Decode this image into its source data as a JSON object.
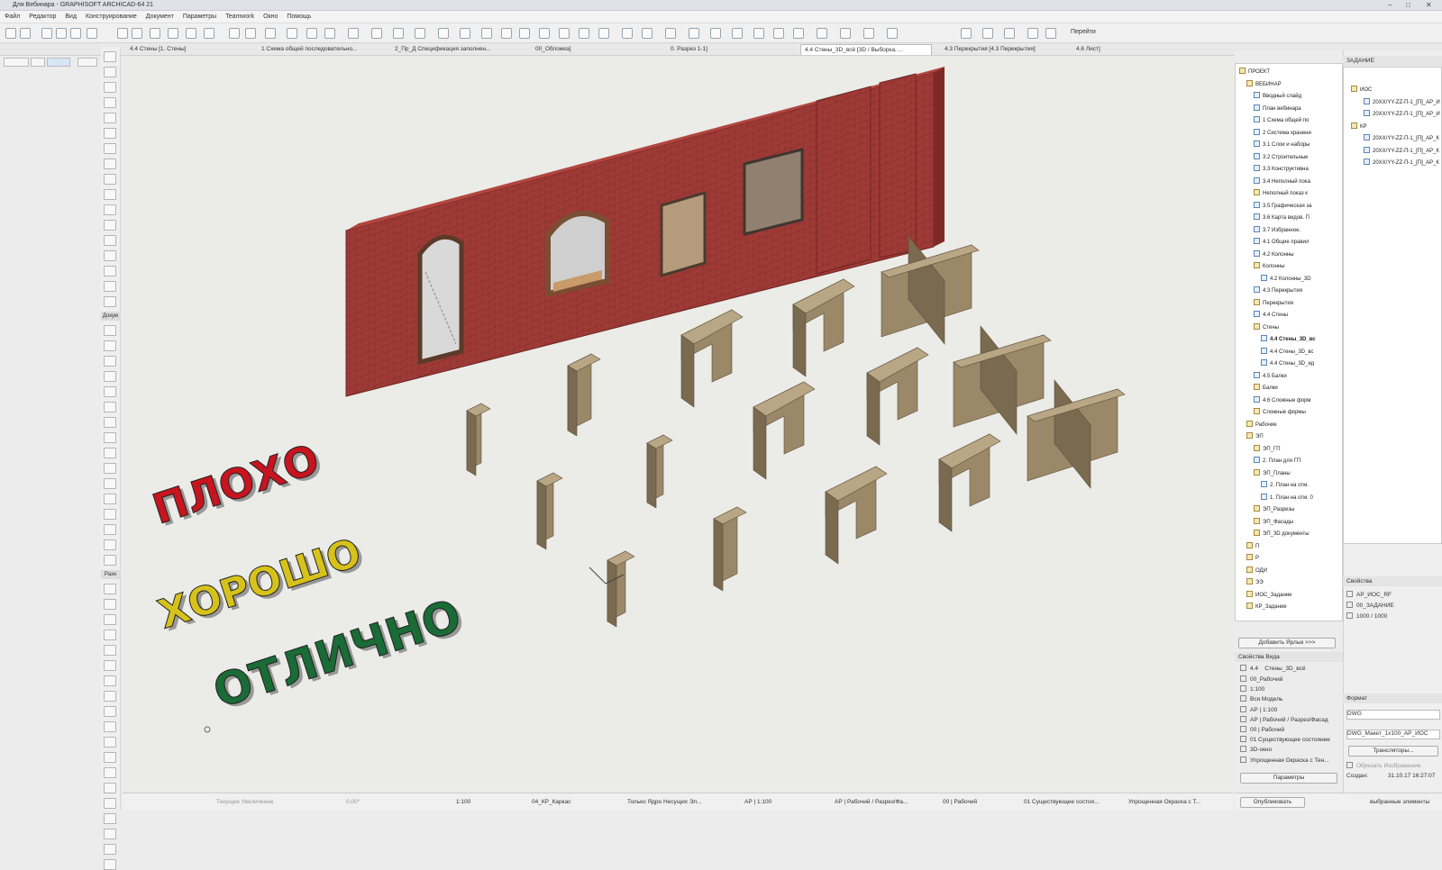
{
  "window": {
    "title": "Для Вебинара - GRAPHISOFT ARCHICAD-64 21",
    "controls": [
      "–",
      "□",
      "✕"
    ]
  },
  "menu": [
    "Файл",
    "Редактор",
    "Вид",
    "Конструирование",
    "Документ",
    "Параметры",
    "Teamwork",
    "Окно",
    "Помощь"
  ],
  "toolbar": {
    "goto_label": "Перейти"
  },
  "tabs": [
    {
      "label": "4.4 Стены [1. Стены]",
      "active": false
    },
    {
      "label": "1 Схема общей последовательно...",
      "active": false
    },
    {
      "label": "2_Пр_Д Спецификация заполнен...",
      "active": false
    },
    {
      "label": "00_Обложка]",
      "active": false
    },
    {
      "label": "0. Разрез 1-1]",
      "active": false
    },
    {
      "label": "4.4 Стены_3D_всё [3D / Выборка, ...",
      "active": true
    },
    {
      "label": "4.3 Перекрытия [4.3 Перекрытия]",
      "active": false
    },
    {
      "label": "4.6 Лист]",
      "active": false
    }
  ],
  "toolbox": {
    "section_design": "Докум",
    "section_docs": "Разн"
  },
  "viewport": {
    "wall_color": "#9e3a36",
    "wall_top_color": "#b2463f",
    "column_color": "#9b8868",
    "column_dark": "#7a6a50",
    "column_light": "#b8a684",
    "labels": [
      {
        "text": "ПЛОХО",
        "color": "#c8141e"
      },
      {
        "text": "ХОРОШО",
        "color": "#d6c21a"
      },
      {
        "text": "ОТЛИЧНО",
        "color": "#1a6b35"
      }
    ]
  },
  "navigator": {
    "items": [
      {
        "label": "ПРОЕКТ",
        "level": 0,
        "type": "folder"
      },
      {
        "label": "ВЕБИНАР",
        "level": 1,
        "type": "folder"
      },
      {
        "label": "Вводный слайд",
        "level": 2,
        "type": "view"
      },
      {
        "label": "План вебинара",
        "level": 2,
        "type": "view"
      },
      {
        "label": "1 Схема общей по",
        "level": 2,
        "type": "view"
      },
      {
        "label": "2 Система хранени",
        "level": 2,
        "type": "view"
      },
      {
        "label": "3.1 Слои и наборы",
        "level": 2,
        "type": "view"
      },
      {
        "label": "3.2 Строительные",
        "level": 2,
        "type": "view"
      },
      {
        "label": "3.3 Конструктивна",
        "level": 2,
        "type": "view"
      },
      {
        "label": "3.4 Неполный пока",
        "level": 2,
        "type": "view"
      },
      {
        "label": "Неполный показ к",
        "level": 2,
        "type": "folder"
      },
      {
        "label": "3.5 Графическая за",
        "level": 2,
        "type": "view"
      },
      {
        "label": "3.6 Карта видов. П",
        "level": 2,
        "type": "view"
      },
      {
        "label": "3.7 Избранное.",
        "level": 2,
        "type": "view"
      },
      {
        "label": "4.1 Общие правил",
        "level": 2,
        "type": "view"
      },
      {
        "label": "4.2 Колонны",
        "level": 2,
        "type": "view"
      },
      {
        "label": "Колонны",
        "level": 2,
        "type": "folder"
      },
      {
        "label": "4.2 Колонны_3D",
        "level": 3,
        "type": "view"
      },
      {
        "label": "4.3 Перекрытия",
        "level": 2,
        "type": "view"
      },
      {
        "label": "Перекрытия",
        "level": 2,
        "type": "folder"
      },
      {
        "label": "4.4 Стены",
        "level": 2,
        "type": "view"
      },
      {
        "label": "Стены",
        "level": 2,
        "type": "folder"
      },
      {
        "label": "4.4 Стены_3D_вс",
        "level": 3,
        "type": "view",
        "selected": true
      },
      {
        "label": "4.4 Стены_3D_вс",
        "level": 3,
        "type": "view"
      },
      {
        "label": "4.4 Стены_3D_ид",
        "level": 3,
        "type": "view"
      },
      {
        "label": "4.5 Балки",
        "level": 2,
        "type": "view"
      },
      {
        "label": "Балки",
        "level": 2,
        "type": "folder"
      },
      {
        "label": "4.6 Сложные форм",
        "level": 2,
        "type": "view"
      },
      {
        "label": "Сложные формы",
        "level": 2,
        "type": "folder"
      },
      {
        "label": "Рабочие",
        "level": 1,
        "type": "folder"
      },
      {
        "label": "ЭП",
        "level": 1,
        "type": "folder"
      },
      {
        "label": "ЭП_ГП",
        "level": 2,
        "type": "folder"
      },
      {
        "label": "2. План для ГП",
        "level": 2,
        "type": "view"
      },
      {
        "label": "ЭП_Планы",
        "level": 2,
        "type": "folder"
      },
      {
        "label": "2. План на отм.",
        "level": 3,
        "type": "view"
      },
      {
        "label": "1. План на отм. 0",
        "level": 3,
        "type": "view"
      },
      {
        "label": "ЭП_Разрезы",
        "level": 2,
        "type": "folder"
      },
      {
        "label": "ЭП_Фасады",
        "level": 2,
        "type": "folder"
      },
      {
        "label": "ЭП_3D документы",
        "level": 2,
        "type": "folder"
      },
      {
        "label": "П",
        "level": 1,
        "type": "folder"
      },
      {
        "label": "Р",
        "level": 1,
        "type": "folder"
      },
      {
        "label": "ОДИ",
        "level": 1,
        "type": "folder"
      },
      {
        "label": "ЭЭ",
        "level": 1,
        "type": "folder"
      },
      {
        "label": "ИОС_Задание",
        "level": 1,
        "type": "folder"
      },
      {
        "label": "КР_Задание",
        "level": 1,
        "type": "folder"
      }
    ],
    "add_shortcut": "Добавить Ярлык >>>"
  },
  "view_props": {
    "header": "Свойства Вида",
    "id": "4.4",
    "name": "Стены_3D_всё",
    "rows": [
      "00_Рабочий",
      "1:100",
      "Вся Модель",
      "АР | 1:100",
      "АР | Рабочий / Разрез/Фасад",
      "00 | Рабочий",
      "01 Существующее состояние",
      "3D-окно",
      "Упрощенная Окраска с Тен..."
    ],
    "params_button": "Параметры"
  },
  "organizer": {
    "header": "ЗАДАНИЕ",
    "tree": [
      {
        "label": "ИОС",
        "type": "folder"
      },
      {
        "label": "20XX/YY-ZZ-П-1_[П]_АР_И",
        "type": "file"
      },
      {
        "label": "20XX/YY-ZZ-П-1_[П]_АР_И",
        "type": "file"
      },
      {
        "label": "КР",
        "type": "folder"
      },
      {
        "label": "20XX/YY-ZZ-П-1_[П]_АР_К",
        "type": "file"
      },
      {
        "label": "20XX/YY-ZZ-П-1_[П]_АР_К",
        "type": "file"
      },
      {
        "label": "20XX/YY-ZZ-П-1_[П]_АР_К",
        "type": "file"
      }
    ],
    "props_header": "Свойства",
    "props": [
      "АР_ИОС_RF",
      "00_ЗАДАНИЕ",
      "1000 / 1000"
    ],
    "format_header": "Формат",
    "format_value": "DWG",
    "format_template": "DWG_Макет_1х100_АР_ИОС",
    "translators_button": "Трансляторы...",
    "crop_label": "Обрезать Изображение",
    "created_label": "Создан:",
    "created_date": "31.10.17 16:27:07"
  },
  "bottom": {
    "publish_button": "Опубликовать",
    "selected_label": "выбранные элементы"
  },
  "status": {
    "zoom": "Текущее Увеличение",
    "angle": "0,00°",
    "scale": "1:100",
    "layer": "04_КР_Каркас",
    "structure": "Только Ядро Несущих Эл...",
    "pen": "АР | 1:100",
    "model": "АР | Рабочий / Разрез/Фа...",
    "renovation": "00 | Рабочий",
    "existing": "01 Существующее состоя...",
    "shading": "Упрощенная Окраска с Т..."
  }
}
